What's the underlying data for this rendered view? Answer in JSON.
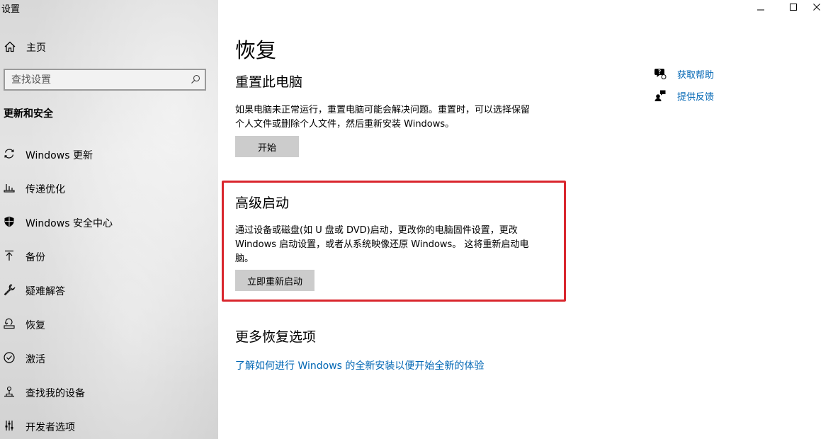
{
  "window": {
    "title": "设置",
    "controls": {
      "minimize": "minimize-icon",
      "maximize": "maximize-icon",
      "close": "close-icon"
    }
  },
  "sidebar": {
    "home_label": "主页",
    "search_placeholder": "查找设置",
    "section_title": "更新和安全",
    "items": [
      {
        "label": "Windows 更新",
        "icon": "refresh-icon"
      },
      {
        "label": "传递优化",
        "icon": "delivery-optimization-icon"
      },
      {
        "label": "Windows 安全中心",
        "icon": "shield-icon"
      },
      {
        "label": "备份",
        "icon": "backup-icon"
      },
      {
        "label": "疑难解答",
        "icon": "wrench-icon"
      },
      {
        "label": "恢复",
        "icon": "recovery-icon"
      },
      {
        "label": "激活",
        "icon": "activation-icon"
      },
      {
        "label": "查找我的设备",
        "icon": "find-device-icon"
      },
      {
        "label": "开发者选项",
        "icon": "developer-icon"
      }
    ]
  },
  "main": {
    "title": "恢复",
    "reset": {
      "heading": "重置此电脑",
      "desc_line1": "如果电脑未正常运行，重置电脑可能会解决问题。重置时，可以选择保留",
      "desc_line2": "个人文件或删除个人文件，然后重新安装 Windows。",
      "button": "开始"
    },
    "advanced": {
      "heading": "高级启动",
      "desc_line1": "通过设备或磁盘(如 U 盘或 DVD)启动，更改你的电脑固件设置，更改",
      "desc_line2": "Windows 启动设置，或者从系统映像还原 Windows。 这将重新启动电",
      "desc_line3": "脑。",
      "button": "立即重新启动"
    },
    "more": {
      "heading": "更多恢复选项",
      "link": "了解如何进行 Windows 的全新安装以便开始全新的体验"
    }
  },
  "help": {
    "get_help": "获取帮助",
    "feedback": "提供反馈"
  },
  "colors": {
    "link": "#0066b4",
    "highlight": "#d9262d",
    "button": "#cccccc"
  }
}
